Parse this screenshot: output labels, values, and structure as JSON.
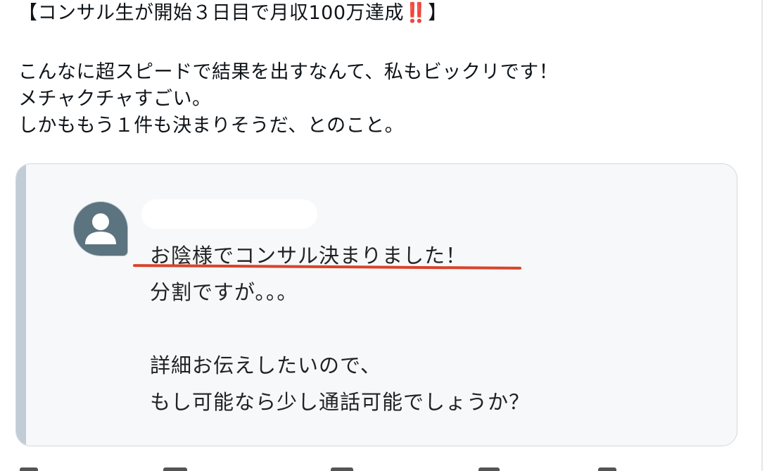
{
  "post": {
    "headline": "【コンサル生が開始３日目で月収100万達成",
    "headline_emoji": "‼️",
    "headline_close": "】",
    "body_lines": [
      "こんなに超スピードで結果を出すなんて、私もビックリです！",
      "メチャクチャすごい。",
      "しかももう１件も決まりそうだ、とのこと。"
    ]
  },
  "embedded_message": {
    "avatar_icon": "default-user-avatar-icon",
    "sender_name": "",
    "lines": [
      "お陰様でコンサル決まりました！",
      "分割ですが。。。",
      "",
      "詳細お伝えしたいので、",
      "もし可能なら少し通話可能でしょうか？"
    ],
    "highlight_color": "#d9432a"
  }
}
